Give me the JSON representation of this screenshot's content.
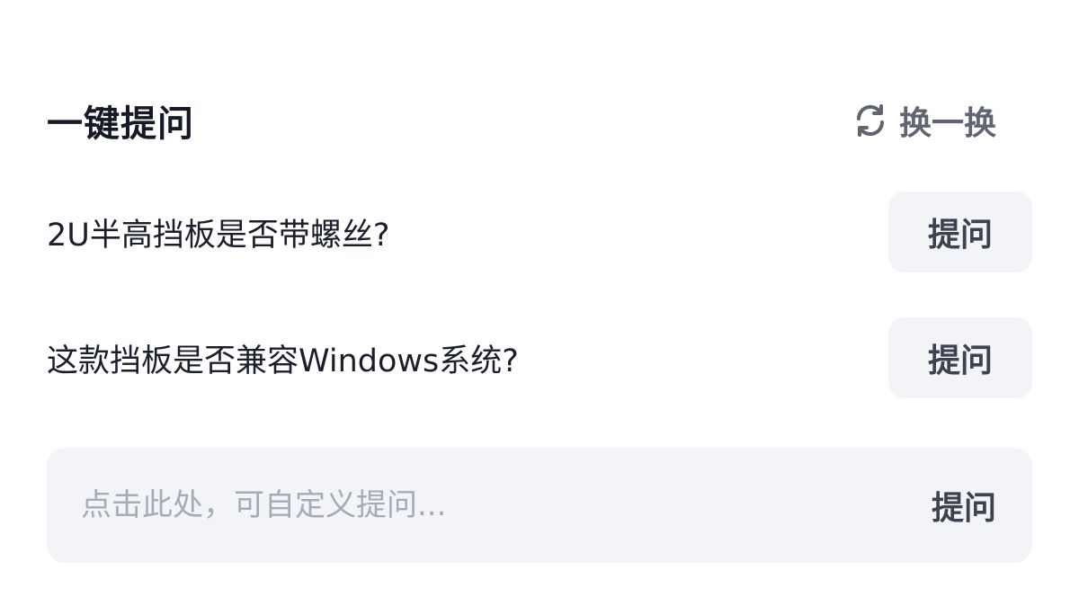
{
  "header": {
    "title": "一键提问",
    "refresh_label": "换一换",
    "refresh_icon": "refresh-icon"
  },
  "questions": [
    {
      "text": "2U半高挡板是否带螺丝?",
      "button_label": "提问"
    },
    {
      "text": "这款挡板是否兼容Windows系统?",
      "button_label": "提问"
    }
  ],
  "custom": {
    "placeholder": "点击此处，可自定义提问...",
    "button_label": "提问"
  },
  "colors": {
    "title": "#151a26",
    "muted": "#5e6470",
    "button_bg": "#f3f4f7",
    "button_text": "#3c4250",
    "placeholder": "#a6abb5"
  }
}
